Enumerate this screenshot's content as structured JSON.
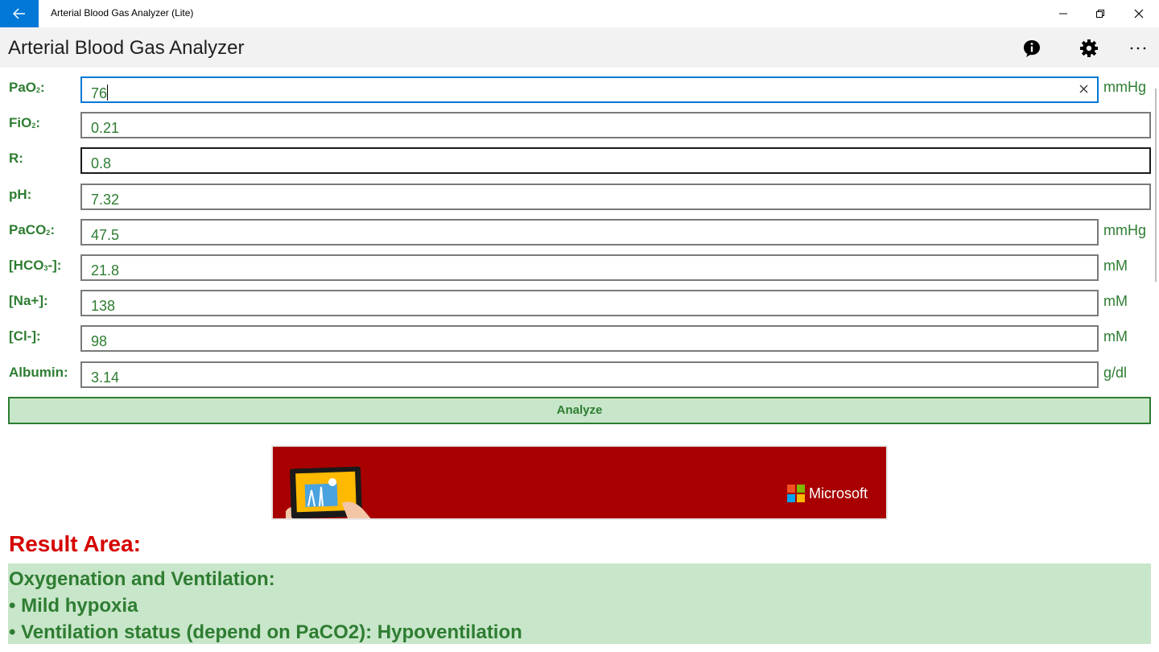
{
  "window": {
    "title": "Arterial Blood Gas Analyzer (Lite)",
    "back_icon": "arrow-left-icon",
    "controls": [
      "minimize-icon",
      "restore-icon",
      "close-icon"
    ],
    "accent_color": "#0078d7"
  },
  "header": {
    "title": "Arterial Blood Gas Analyzer",
    "buttons": [
      "info-icon",
      "gear-icon",
      "more-icon"
    ]
  },
  "form": {
    "fields": [
      {
        "label": "PaO",
        "sub": "2",
        "suffix": ":",
        "value": "76",
        "unit": "mmHg"
      },
      {
        "label": "FiO",
        "sub": "2",
        "suffix": ":",
        "value": "0.21",
        "unit": ""
      },
      {
        "label": "R:",
        "sub": "",
        "suffix": "",
        "value": "0.8",
        "unit": ""
      },
      {
        "label": "pH:",
        "sub": "",
        "suffix": "",
        "value": "7.32",
        "unit": ""
      },
      {
        "label": "PaCO",
        "sub": "2",
        "suffix": ":",
        "value": "47.5",
        "unit": "mmHg"
      },
      {
        "label": "[HCO",
        "sub": "3",
        "suffix": "-]:",
        "value": "21.8",
        "unit": "mM"
      },
      {
        "label": "[Na+]:",
        "sub": "",
        "suffix": "",
        "value": "138",
        "unit": "mM"
      },
      {
        "label": "[Cl-]:",
        "sub": "",
        "suffix": "",
        "value": "98",
        "unit": "mM"
      },
      {
        "label": "Albumin:",
        "sub": "",
        "suffix": "",
        "value": "3.14",
        "unit": "g/dl"
      }
    ],
    "analyze_label": "Analyze"
  },
  "ad": {
    "brand": "Microsoft",
    "background_color": "#a80000"
  },
  "results": {
    "title": "Result Area:",
    "lines": [
      "Oxygenation and Ventilation:",
      " • Mild hypoxia",
      " • Ventilation status (depend on PaCO2): Hypoventilation"
    ]
  },
  "colors": {
    "label_green": "#2e7d32",
    "result_bg": "#c8e6c9",
    "result_title_red": "#d50000"
  }
}
